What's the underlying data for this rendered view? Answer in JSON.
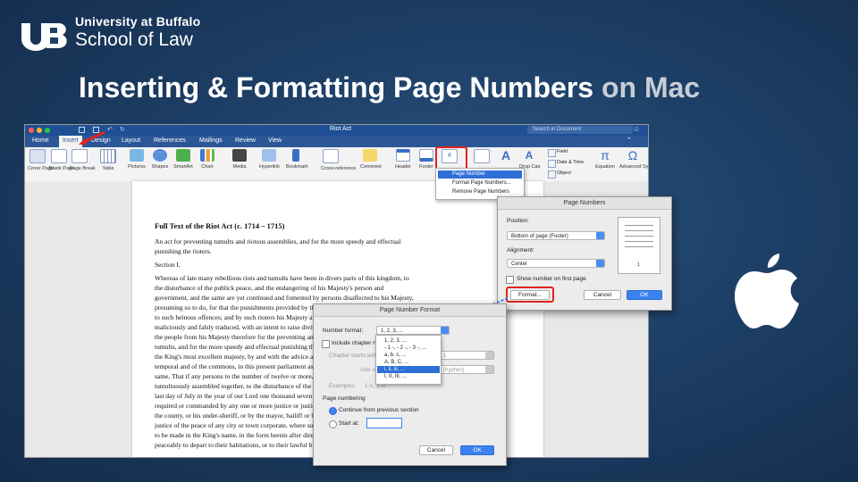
{
  "brand": {
    "university": "University at Buffalo",
    "school": "School of Law"
  },
  "slide": {
    "title_main": "Inserting & Formatting Page Numbers",
    "title_accent": "on Mac"
  },
  "word": {
    "window_title": "Riot Act",
    "search_placeholder": "Search in Document",
    "menu": [
      "Home",
      "Insert",
      "Design",
      "Layout",
      "References",
      "Mailings",
      "Review",
      "View"
    ],
    "ribbon": [
      "Cover Page",
      "Blank Page",
      "Page Break",
      "Table",
      "Pictures",
      "Shapes",
      "SmartArt",
      "Chart",
      "Media",
      "Hyperlink",
      "Bookmark",
      "Cross-reference",
      "Comment",
      "Header",
      "Footer",
      "Page Number",
      "Drop Cap",
      "Equation",
      "Advanced Symbol"
    ],
    "ribbon_right": {
      "field": "Field",
      "date_time": "Date & Time",
      "object": "Object"
    },
    "page_number_menu": [
      "Page Number",
      "Format Page Numbers...",
      "Remove Page Numbers"
    ]
  },
  "document": {
    "heading": "Full Text of the Riot Act (c. 1714 – 1715)",
    "lines": [
      "An act for preventing tumults and riotous assemblies, and for the more speedy and effectual",
      "punishing the rioters.",
      "",
      "Section I.",
      "",
      "Whereas of late many rebellious riots and tumults have been in divers parts of this kingdom, to",
      "the disturbance of the publick peace, and the endangering of his Majesty's person and",
      "government, and the same are yet continued and fomented by persons disaffected to his Majesty,",
      "presuming so to do, for that the punishments provided by the laws now in being are not adequate",
      "to such heinous offences; and by such rioters his Majesty and his administration have been most",
      "maliciously and falsly traduced, with an intent to raise divisions, and to alienate the affections of",
      "the people from his Majesty therefore for the preventing and suppressing of such riots and",
      "tumults, and for the more speedy and effectual punishing the offenders therein; be it enacted by",
      "the King's most excellent majesty, by and with the advice and consent of the lords spiritual and",
      "temporal and of the commons, in this present parliament assembled, and by the authority of the",
      "same, That if any persons to the number of twelve or more, being unlawfully, riotously, and",
      "tumultuously assembled together, to the disturbance of the publick peace, at any time after the",
      "last day of July in the year of our Lord one thousand seven hundred and fifteen, and being",
      "required or commanded by any one or more justice or justices of the peace, or by the sheriff of",
      "the county, or his under-sheriff, or by the mayor, bailiff or bailiffs, or other head-officer, or",
      "justice of the peace of any city or town corporate, where such assembly shall be, by proclamation",
      "to be made in the King's name, in the form herein after directed, to disperse themselves, and",
      "peaceably to depart to their habitations, or to their lawful business"
    ]
  },
  "page_numbers_dialog": {
    "title": "Page Numbers",
    "position_label": "Position:",
    "position_value": "Bottom of page (Footer)",
    "alignment_label": "Alignment:",
    "alignment_value": "Center",
    "show_first_label": "Show number on first page",
    "format_button": "Format...",
    "cancel_button": "Cancel",
    "ok_button": "OK",
    "preview_number": "1"
  },
  "page_number_format_dialog": {
    "title": "Page Number Format",
    "number_format_label": "Number format:",
    "number_format_value": "1, 2, 3, ...",
    "include_chapter_label": "Include chapter number",
    "chapter_starts_label": "Chapter starts with style",
    "chapter_style_value": "1",
    "use_separator_label": "Use separator:",
    "separator_value": "(hyphen)",
    "examples_label": "Examples:",
    "examples_value": "1-1, 1-A",
    "page_numbering_label": "Page numbering",
    "continue_label": "Continue from previous section",
    "start_at_label": "Start at:",
    "cancel_button": "Cancel",
    "ok_button": "OK",
    "format_options": [
      "1, 2, 3, ...",
      "- 1 -, - 2 -, - 3 -, ...",
      "a, b, c, ...",
      "A, B, C, ...",
      "i, ii, iii, ...",
      "I, II, III, ..."
    ]
  },
  "colors": {
    "background": "#1d3f66",
    "word_blue": "#2b5797",
    "highlight_red": "#e0231e",
    "selection_blue": "#2f6fd8"
  }
}
